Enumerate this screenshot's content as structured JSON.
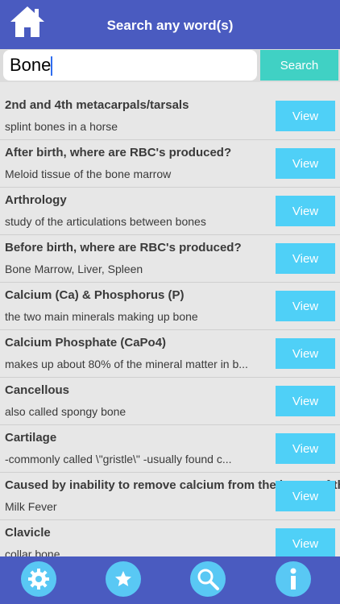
{
  "header": {
    "title": "Search any word(s)"
  },
  "search": {
    "value": "Bone",
    "button_label": "Search"
  },
  "results": [
    {
      "term": "2nd and 4th metacarpals/tarsals",
      "definition": "splint bones in a horse",
      "view_label": "View"
    },
    {
      "term": "After birth, where are RBC's produced?",
      "definition": "Meloid tissue of the bone marrow",
      "view_label": "View"
    },
    {
      "term": "Arthrology",
      "definition": "study of the articulations between bones",
      "view_label": "View"
    },
    {
      "term": "Before birth, where are RBC's produced?",
      "definition": "Bone Marrow, Liver, Spleen",
      "view_label": "View"
    },
    {
      "term": "Calcium (Ca) & Phosphorus (P)",
      "definition": "the two main minerals making up bone",
      "view_label": "View"
    },
    {
      "term": "Calcium Phosphate (CaPo4)",
      "definition": "makes up about 80% of the mineral matter in b...",
      "view_label": "View"
    },
    {
      "term": "Cancellous",
      "definition": "also called spongy bone",
      "view_label": "View"
    },
    {
      "term": "Cartilage",
      "definition": "-commonly called \\\"gristle\\\" -usually found c...",
      "view_label": "View"
    },
    {
      "term": "Caused by inability to remove calcium from the bones of the p",
      "definition": "Milk Fever",
      "view_label": "View"
    },
    {
      "term": "Clavicle",
      "definition": "collar bone",
      "view_label": "View"
    }
  ],
  "tabbar": {
    "items": [
      {
        "icon": "gear-icon"
      },
      {
        "icon": "star-icon"
      },
      {
        "icon": "search-icon"
      },
      {
        "icon": "info-icon"
      }
    ]
  },
  "colors": {
    "header": "#4a5bc0",
    "search_button": "#40d1c4",
    "view_button": "#4fd0f7",
    "tab_icon_bg": "#59c8f4"
  }
}
